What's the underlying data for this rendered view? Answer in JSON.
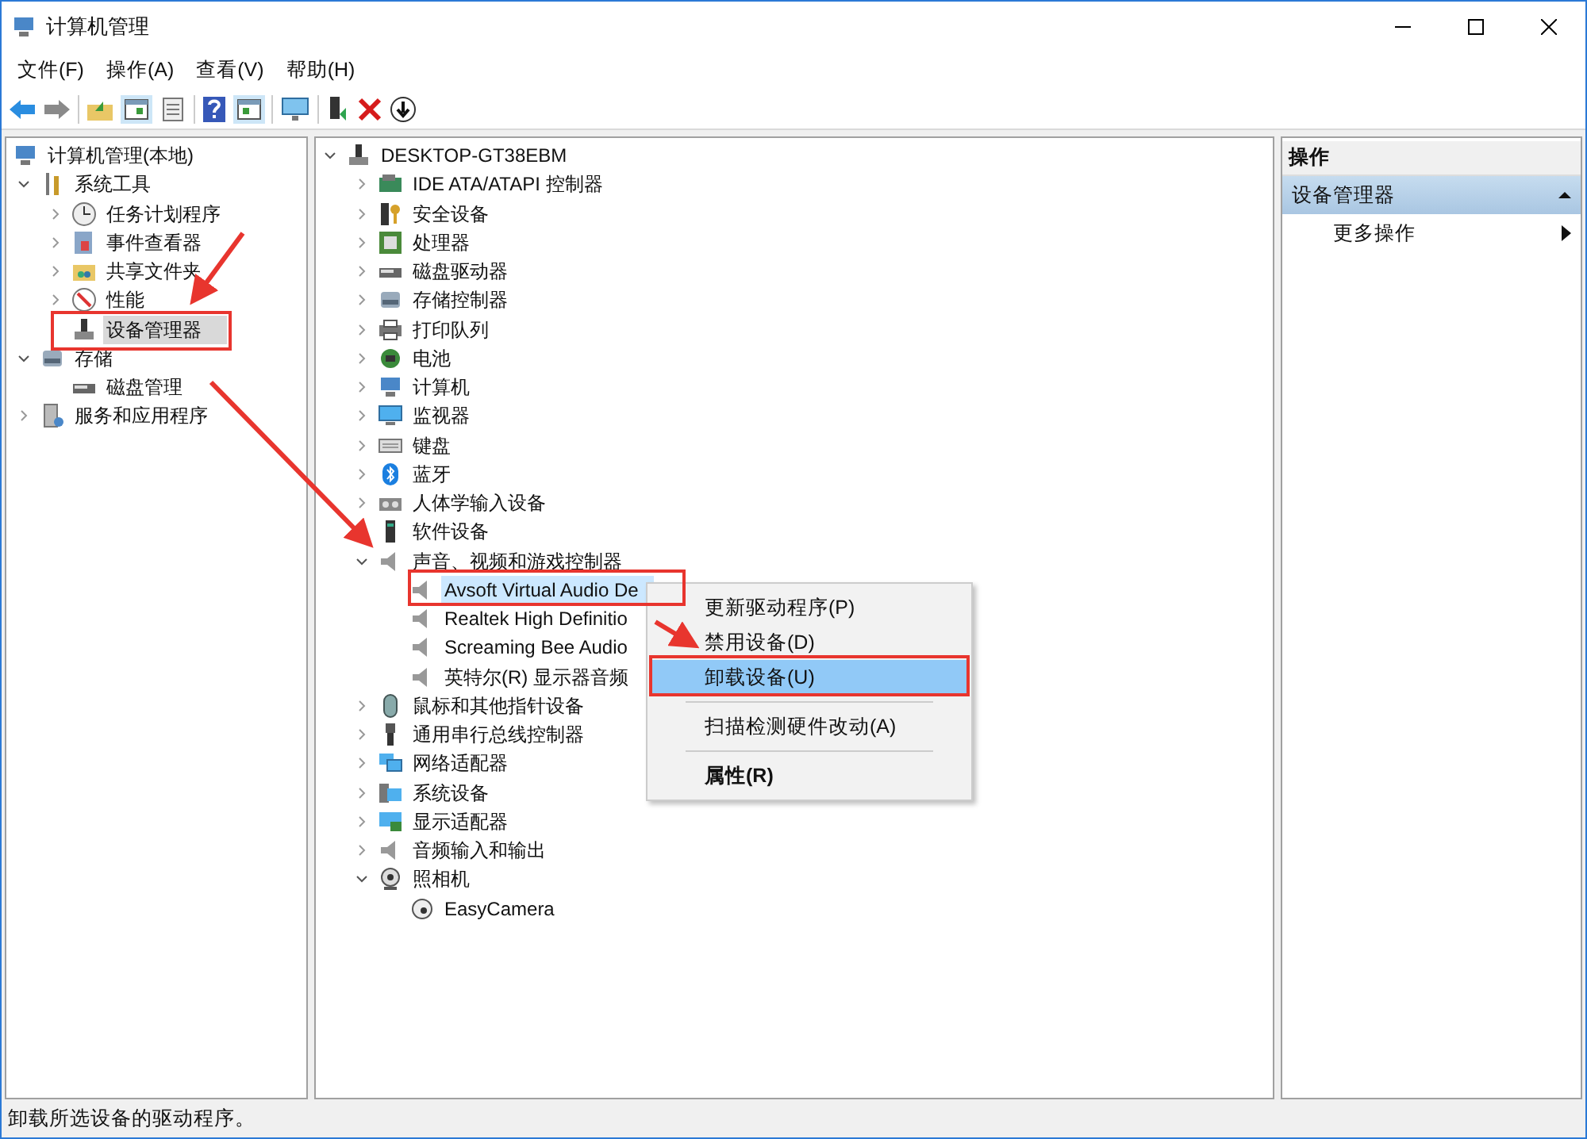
{
  "window": {
    "title": "计算机管理"
  },
  "menu_bar": [
    {
      "label": "文件(F)"
    },
    {
      "label": "操作(A)"
    },
    {
      "label": "查看(V)"
    },
    {
      "label": "帮助(H)"
    }
  ],
  "left_tree": [
    {
      "label": "计算机管理(本地)",
      "selected": false,
      "children": [
        {
          "label": "系统工具",
          "expanded": true,
          "selected": false,
          "children": [
            {
              "label": "任务计划程序",
              "expanded": false,
              "selected": false
            },
            {
              "label": "事件查看器",
              "expanded": false,
              "selected": false
            },
            {
              "label": "共享文件夹",
              "expanded": false,
              "selected": false
            },
            {
              "label": "性能",
              "expanded": false,
              "selected": false
            },
            {
              "label": "设备管理器",
              "selected": true
            }
          ]
        },
        {
          "label": "存储",
          "expanded": true,
          "selected": false,
          "children": [
            {
              "label": "磁盘管理",
              "selected": false
            }
          ]
        },
        {
          "label": "服务和应用程序",
          "expanded": false,
          "selected": false
        }
      ]
    }
  ],
  "device_tree": [
    {
      "label": "DESKTOP-GT38EBM",
      "expanded": true,
      "selected": false,
      "children": [
        {
          "label": "IDE ATA/ATAPI 控制器",
          "expanded": false,
          "selected": false
        },
        {
          "label": "安全设备",
          "expanded": false,
          "selected": false
        },
        {
          "label": "处理器",
          "expanded": false,
          "selected": false
        },
        {
          "label": "磁盘驱动器",
          "expanded": false,
          "selected": false
        },
        {
          "label": "存储控制器",
          "expanded": false,
          "selected": false
        },
        {
          "label": "打印队列",
          "expanded": false,
          "selected": false
        },
        {
          "label": "电池",
          "expanded": false,
          "selected": false
        },
        {
          "label": "计算机",
          "expanded": false,
          "selected": false
        },
        {
          "label": "监视器",
          "expanded": false,
          "selected": false
        },
        {
          "label": "键盘",
          "expanded": false,
          "selected": false
        },
        {
          "label": "蓝牙",
          "expanded": false,
          "selected": false
        },
        {
          "label": "人体学输入设备",
          "expanded": false,
          "selected": false
        },
        {
          "label": "软件设备",
          "expanded": false,
          "selected": false
        },
        {
          "label": "声音、视频和游戏控制器",
          "expanded": true,
          "selected": false,
          "children": [
            {
              "label": "Avsoft Virtual Audio De",
              "selected": true
            },
            {
              "label": "Realtek High Definitio",
              "selected": false
            },
            {
              "label": "Screaming Bee Audio",
              "selected": false
            },
            {
              "label": "英特尔(R) 显示器音频",
              "selected": false
            }
          ]
        },
        {
          "label": "鼠标和其他指针设备",
          "expanded": false,
          "selected": false
        },
        {
          "label": "通用串行总线控制器",
          "expanded": false,
          "selected": false
        },
        {
          "label": "网络适配器",
          "expanded": false,
          "selected": false
        },
        {
          "label": "系统设备",
          "expanded": false,
          "selected": false
        },
        {
          "label": "显示适配器",
          "expanded": false,
          "selected": false
        },
        {
          "label": "音频输入和输出",
          "expanded": false,
          "selected": false
        },
        {
          "label": "照相机",
          "expanded": true,
          "selected": false,
          "children": [
            {
              "label": "EasyCamera",
              "selected": false
            }
          ]
        }
      ]
    }
  ],
  "context_menu": [
    {
      "kind": "command",
      "label": "更新驱动程序(P)",
      "selected": false
    },
    {
      "kind": "command",
      "label": "禁用设备(D)",
      "selected": false
    },
    {
      "kind": "command",
      "label": "卸载设备(U)",
      "selected": true
    },
    {
      "kind": "separator"
    },
    {
      "kind": "command",
      "label": "扫描检测硬件改动(A)",
      "selected": false
    },
    {
      "kind": "separator"
    },
    {
      "kind": "default",
      "label": "属性(R)",
      "selected": false
    }
  ],
  "actions_pane": {
    "title": "操作",
    "section": {
      "label": "设备管理器",
      "expanded": true
    },
    "items": [
      {
        "label": "更多操作"
      }
    ]
  },
  "status_bar": {
    "text": "卸载所选设备的驱动程序。"
  }
}
